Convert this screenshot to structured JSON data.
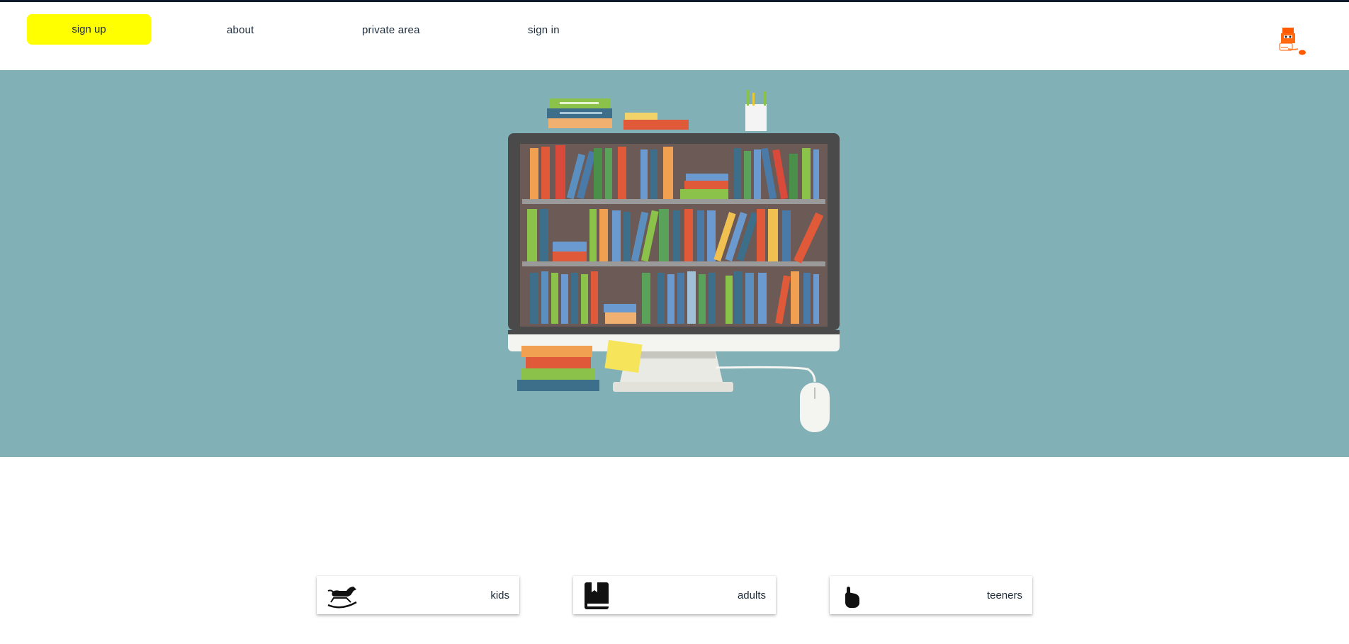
{
  "nav": {
    "signup_label": "sign up",
    "about_label": "about",
    "private_label": "private area",
    "signin_label": "sign in"
  },
  "logo": {
    "icon": "bookworm-logo-icon",
    "color": "#ff5a00"
  },
  "hero": {
    "image": "bookshelf-computer-illustration",
    "background": "#82b0b7"
  },
  "cards": [
    {
      "label": "kids",
      "icon": "rocking-horse-icon"
    },
    {
      "label": "adults",
      "icon": "book-icon"
    },
    {
      "label": "teeners",
      "icon": "pointing-hand-icon"
    }
  ],
  "colors": {
    "accent": "#ffff00",
    "text": "#1d2b3a",
    "hero_bg": "#82b0b7"
  }
}
